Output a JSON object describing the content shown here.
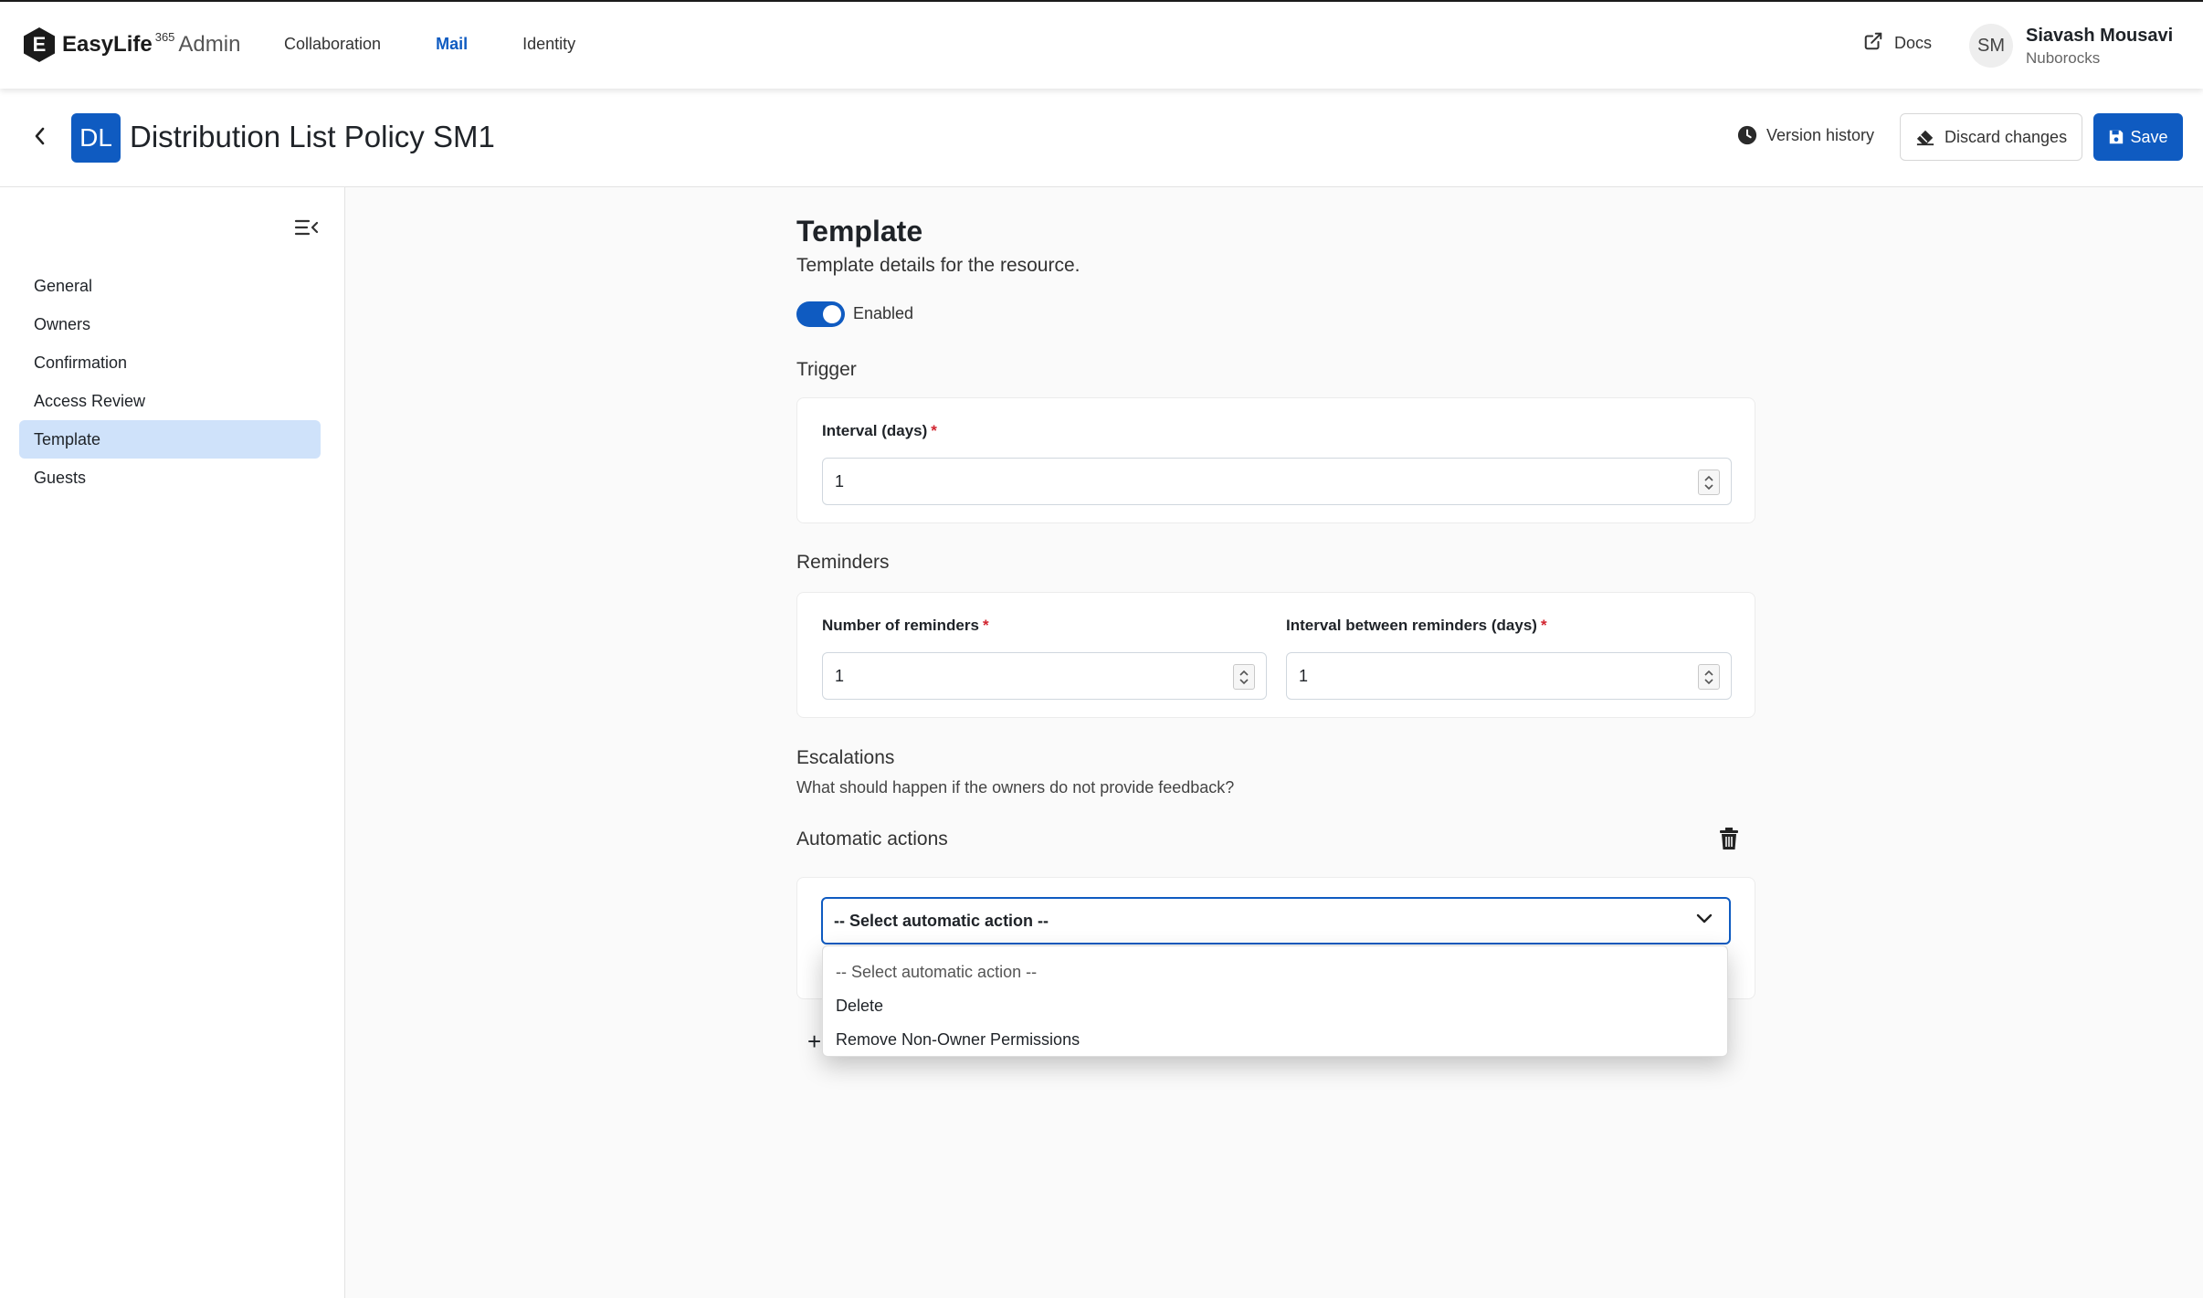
{
  "brand": {
    "name": "EasyLife",
    "superscript": "365",
    "suffix": "Admin",
    "logo_letter": "E"
  },
  "topnav": {
    "items": [
      "Collaboration",
      "Mail",
      "Identity"
    ],
    "active": "Mail"
  },
  "header_links": {
    "docs": "Docs"
  },
  "user": {
    "initials": "SM",
    "name": "Siavash Mousavi",
    "org": "Nuborocks"
  },
  "page": {
    "badge": "DL",
    "title": "Distribution List Policy SM1",
    "version_history": "Version history",
    "discard": "Discard changes",
    "save": "Save"
  },
  "sidebar": {
    "items": [
      "General",
      "Owners",
      "Confirmation",
      "Access Review",
      "Template",
      "Guests"
    ],
    "active": "Template"
  },
  "section": {
    "title": "Template",
    "subtitle": "Template details for the resource.",
    "toggle_label": "Enabled",
    "toggle_on": true,
    "trigger": {
      "title": "Trigger",
      "interval_label": "Interval (days)",
      "interval_value": "1"
    },
    "reminders": {
      "title": "Reminders",
      "count_label": "Number of reminders",
      "count_value": "1",
      "interval_label": "Interval between reminders (days)",
      "interval_value": "1"
    },
    "escalations": {
      "title": "Escalations",
      "subtitle": "What should happen if the owners do not provide feedback?"
    },
    "automatic_actions": {
      "title": "Automatic actions",
      "selected": "-- Select automatic action --",
      "options": [
        "-- Select automatic action --",
        "Delete",
        "Remove Non-Owner Permissions"
      ]
    },
    "add_symbol": "+",
    "required_mark": "*"
  },
  "colors": {
    "accent": "#0f5bc1",
    "active_nav_bg": "#cfe2fa",
    "required": "#d1242f"
  }
}
